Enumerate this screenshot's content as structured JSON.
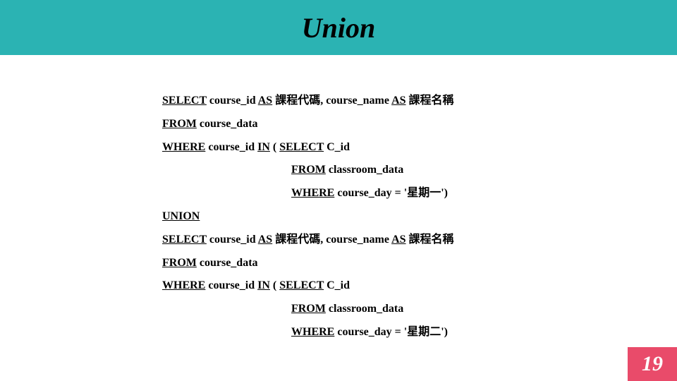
{
  "slide": {
    "title": "Union",
    "page_number": "19"
  },
  "sql": {
    "l1_a": "SELECT",
    "l1_b": " course_id ",
    "l1_c": "AS",
    "l1_d": " 課程代碼, course_name ",
    "l1_e": "AS",
    "l1_f": " 課程名稱",
    "l2_a": "FROM",
    "l2_b": " course_data",
    "l3_a": "WHERE",
    "l3_b": " course_id ",
    "l3_c": "IN",
    "l3_d": " (  ",
    "l3_e": "SELECT",
    "l3_f": " C_id",
    "l4_a": "FROM",
    "l4_b": " classroom_data",
    "l5_a": "WHERE",
    "l5_b": " course_day = '星期一')",
    "l6_a": "UNION",
    "l7_a": "SELECT",
    "l7_b": " course_id ",
    "l7_c": "AS",
    "l7_d": " 課程代碼, course_name ",
    "l7_e": "AS",
    "l7_f": " 課程名稱",
    "l8_a": "FROM",
    "l8_b": " course_data",
    "l9_a": "WHERE",
    "l9_b": " course_id ",
    "l9_c": "IN",
    "l9_d": " (  ",
    "l9_e": "SELECT",
    "l9_f": " C_id",
    "l10_a": "FROM",
    "l10_b": " classroom_data",
    "l11_a": "WHERE",
    "l11_b": " course_day = '星期二')"
  }
}
